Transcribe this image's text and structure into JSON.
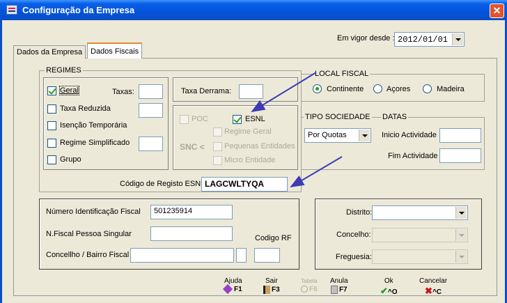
{
  "window": {
    "title": "Configuração da Empresa",
    "close_glyph": "✕"
  },
  "vigor": {
    "label": "Em vigor desde :",
    "value": "2012/01/01"
  },
  "tabs": [
    {
      "label": "Dados da Empresa"
    },
    {
      "label": "Dados Fiscais"
    }
  ],
  "regimes": {
    "title": "REGIMES",
    "items": [
      {
        "label": "Geral",
        "checked": true
      },
      {
        "label": "Taxa Reduzida",
        "checked": false
      },
      {
        "label": "Isenção Temporária",
        "checked": false
      },
      {
        "label": "Regime Simplificado",
        "checked": false
      },
      {
        "label": "Grupo",
        "checked": false
      }
    ],
    "taxas_label": "Taxas:",
    "taxa_derrama_label": "Taxa Derrama:"
  },
  "snc": {
    "poc": "POC",
    "esnl": "ESNL",
    "prefix": "SNC <",
    "regime_geral": "Regime Geral",
    "pequenas": "Pequenas Entidades",
    "micro": "Micro Entidade"
  },
  "codigo_esnl": {
    "label": "Código de Registo ESNL:",
    "value": "LAGCWLTYQA"
  },
  "local_fiscal": {
    "title": "LOCAL FISCAL",
    "options": [
      "Continente",
      "Açores",
      "Madeira"
    ],
    "selected": "Continente"
  },
  "tipo_sociedade": {
    "title": "TIPO SOCIEDADE",
    "value": "Por Quotas"
  },
  "datas": {
    "title": "DATAS",
    "inicio_label": "Inicio Actividade",
    "fim_label": "Fim Actividade"
  },
  "fiscal": {
    "nif_label": "Número Identificação Fiscal",
    "nif_value": "501235914",
    "nif_singular_label": "N.Fiscal Pessoa Singular",
    "codigo_rf_label": "Codigo RF",
    "concelho_bairro_label": "Concellho / Bairro Fiscal"
  },
  "location": {
    "distrito": "Distrito:",
    "concelho": "Concelho:",
    "freguesia": "Freguesia:"
  },
  "toolbar": [
    {
      "label": "Ajuda",
      "key": "F1",
      "icon": "diamond-icon",
      "enabled": true
    },
    {
      "label": "Sair",
      "key": "F3",
      "icon": "exit-door-icon",
      "enabled": true
    },
    {
      "label": "Tabela",
      "key": "F6",
      "icon": "table-search-icon",
      "enabled": false
    },
    {
      "label": "Anula",
      "key": "F7",
      "icon": "trash-icon",
      "enabled": true
    },
    {
      "label": "Ok",
      "key": "^O",
      "icon": "checkmark-icon",
      "enabled": true
    },
    {
      "label": "Cancelar",
      "key": "^C",
      "icon": "x-mark-icon",
      "enabled": true
    }
  ],
  "colors": {
    "title_bar": "#0a5fe8",
    "window_bg": "#ece9d8",
    "arrow": "#3c3cb4",
    "check": "#21a121"
  }
}
